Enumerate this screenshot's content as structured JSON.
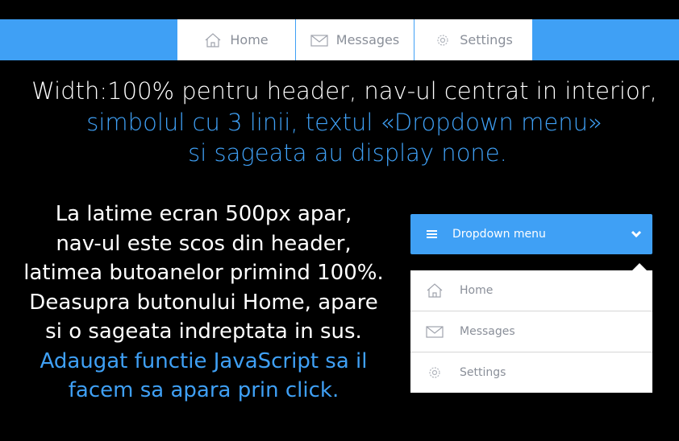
{
  "nav": {
    "items": [
      {
        "label": "Home",
        "icon": "home-icon"
      },
      {
        "label": "Messages",
        "icon": "envelope-icon"
      },
      {
        "label": "Settings",
        "icon": "gear-icon"
      }
    ]
  },
  "text": {
    "line1": "Width:100% pentru header, nav-ul centrat in interior,",
    "line2": "simbolul cu 3 linii, textul «Dropdown menu»",
    "line3": "si sageata au display none.",
    "left": [
      "La latime ecran 500px apar,",
      "nav-ul este scos din header,",
      "latimea butoanelor primind 100%.",
      "Deasupra butonului Home, apare",
      "si o sageata indreptata in sus."
    ],
    "left_blue": [
      "Adaugat functie JavaScript sa il",
      "facem sa apara prin click."
    ]
  },
  "dropdown": {
    "label": "Dropdown menu",
    "items": [
      {
        "label": "Home"
      },
      {
        "label": "Messages"
      },
      {
        "label": "Settings"
      }
    ]
  },
  "colors": {
    "accent": "#3fa0f5",
    "text_gray": "#8a8f99"
  }
}
